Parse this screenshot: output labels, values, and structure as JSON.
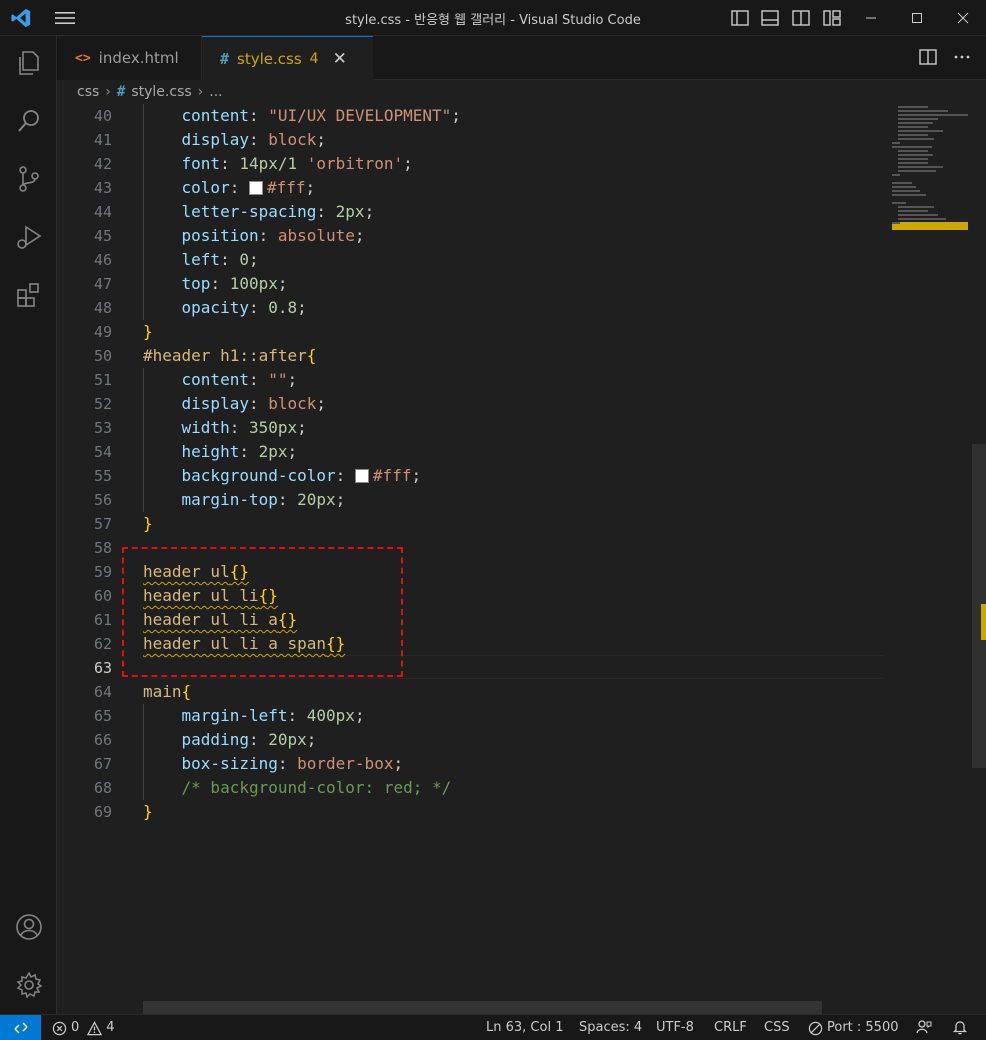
{
  "window": {
    "title": "style.css - 반응형 웹 갤러리 - Visual Studio Code"
  },
  "icons": {
    "logo": "vscode-logo-icon",
    "menu": "hamburger-menu-icon"
  },
  "tabs": [
    {
      "label": "index.html",
      "icon": "html-file-icon",
      "icon_glyph": "<>",
      "active": false
    },
    {
      "label": "style.css",
      "icon": "css-file-icon",
      "icon_glyph": "#",
      "badge": "4",
      "active": true
    }
  ],
  "breadcrumb": {
    "folder": "css",
    "file": "style.css",
    "more": "..."
  },
  "editor": {
    "current_line": "63",
    "line_numbers": [
      "40",
      "41",
      "42",
      "43",
      "44",
      "45",
      "46",
      "47",
      "48",
      "49",
      "50",
      "51",
      "52",
      "53",
      "54",
      "55",
      "56",
      "57",
      "58",
      "59",
      "60",
      "61",
      "62",
      "63",
      "64",
      "65",
      "66",
      "67",
      "68",
      "69"
    ],
    "code": {
      "l40": {
        "prop": "content",
        "value": "\"UI/UX DEVELOPMENT\""
      },
      "l41": {
        "prop": "display",
        "value": "block"
      },
      "l42": {
        "prop": "font",
        "num": "14px/1",
        "str": "'orbitron'"
      },
      "l43": {
        "prop": "color",
        "value": "#fff"
      },
      "l44": {
        "prop": "letter-spacing",
        "value": "2px"
      },
      "l45": {
        "prop": "position",
        "value": "absolute"
      },
      "l46": {
        "prop": "left",
        "value": "0"
      },
      "l47": {
        "prop": "top",
        "value": "100px"
      },
      "l48": {
        "prop": "opacity",
        "value": "0.8"
      },
      "l49": {
        "brace": "}"
      },
      "l50": {
        "selector": "#header h1::after",
        "brace": "{"
      },
      "l51": {
        "prop": "content",
        "value": "\"\""
      },
      "l52": {
        "prop": "display",
        "value": "block"
      },
      "l53": {
        "prop": "width",
        "value": "350px"
      },
      "l54": {
        "prop": "height",
        "value": "2px"
      },
      "l55": {
        "prop": "background-color",
        "value": "#fff"
      },
      "l56": {
        "prop": "margin-top",
        "value": "20px"
      },
      "l57": {
        "brace": "}"
      },
      "l59": {
        "selector": "header ul",
        "brace": "{}"
      },
      "l60": {
        "selector": "header ul li",
        "brace": "{}"
      },
      "l61": {
        "selector": "header ul li a",
        "brace": "{}"
      },
      "l62": {
        "selector": "header ul li a span",
        "brace": "{}"
      },
      "l64": {
        "selector": "main",
        "brace": "{"
      },
      "l65": {
        "prop": "margin-left",
        "value": "400px"
      },
      "l66": {
        "prop": "padding",
        "value": "20px"
      },
      "l67": {
        "prop": "box-sizing",
        "value": "border-box"
      },
      "l68": {
        "comment": "/* background-color: red; */"
      },
      "l69": {
        "brace": "}"
      }
    }
  },
  "statusbar": {
    "errors": "0",
    "warnings": "4",
    "position": "Ln 63, Col 1",
    "spaces": "Spaces: 4",
    "encoding": "UTF-8",
    "eol": "CRLF",
    "language": "CSS",
    "port": "Port : 5500"
  },
  "colors": {
    "accent": "#0078d4",
    "warning": "#cca700",
    "highlight_box": "#e01010"
  }
}
